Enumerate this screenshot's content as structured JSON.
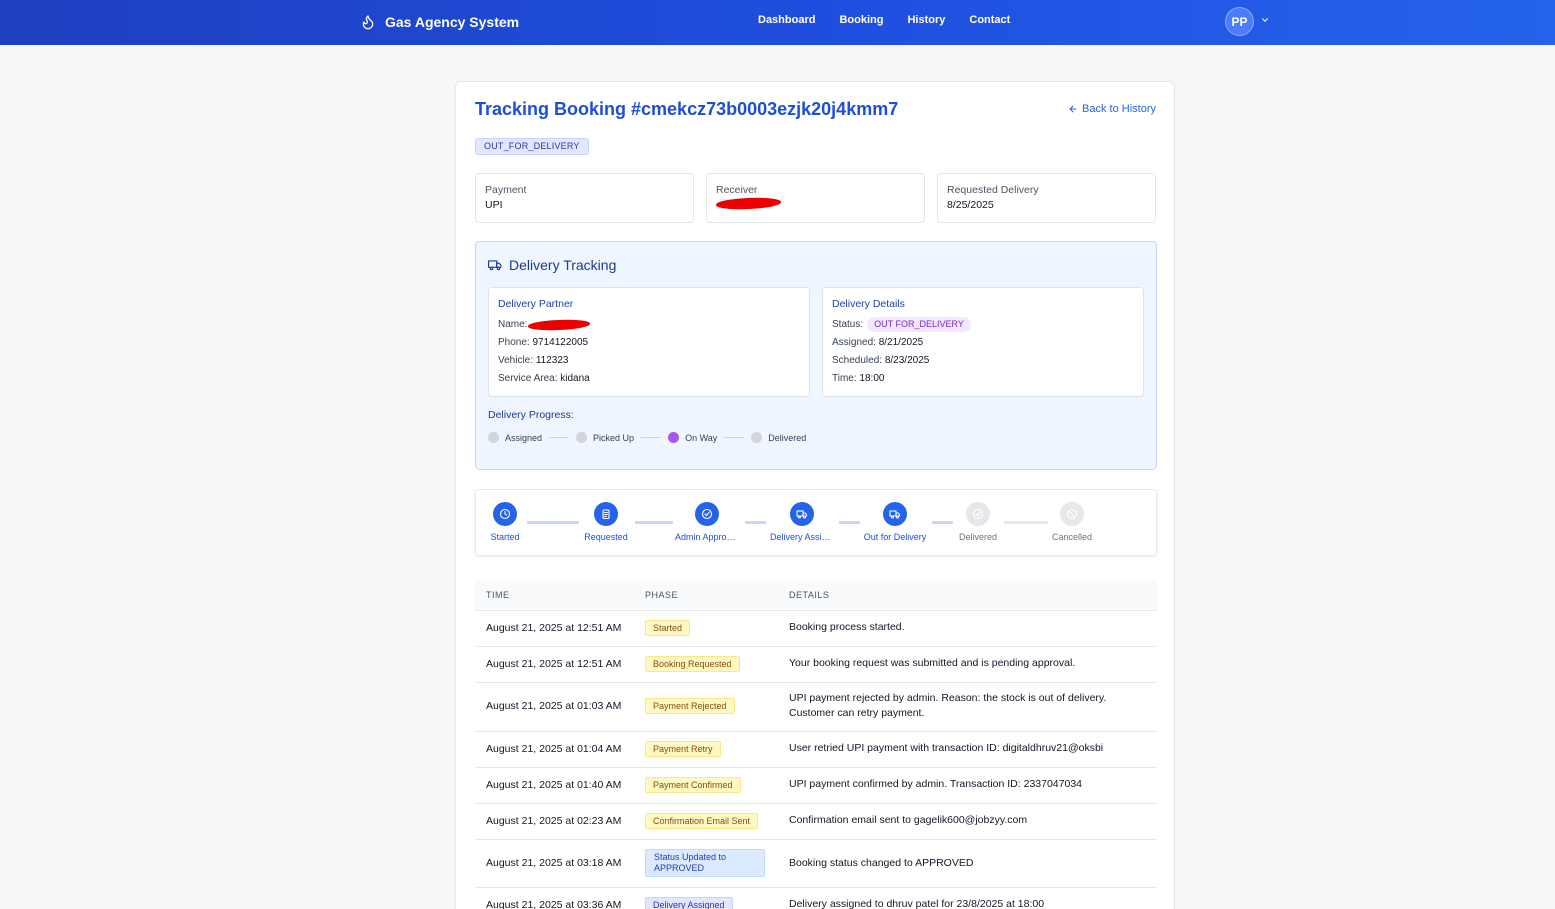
{
  "header": {
    "brand": "Gas Agency System",
    "nav": [
      "Dashboard",
      "Booking",
      "History",
      "Contact"
    ],
    "avatar_initials": "PP"
  },
  "page": {
    "title": "Tracking Booking #cmekcz73b0003ezjk20j4kmm7",
    "back_label": "Back to History",
    "status": "OUT_FOR_DELIVERY"
  },
  "info_cards": {
    "payment_label": "Payment",
    "payment_value": "UPI",
    "receiver_label": "Receiver",
    "requested_label": "Requested Delivery",
    "requested_value": "8/25/2025"
  },
  "delivery_tracking": {
    "title": "Delivery Tracking",
    "partner": {
      "heading": "Delivery Partner",
      "name_label": "Name:",
      "phone_label": "Phone:",
      "phone": "9714122005",
      "vehicle_label": "Vehicle:",
      "vehicle": "112323",
      "area_label": "Service Area:",
      "area": "kidana"
    },
    "details": {
      "heading": "Delivery Details",
      "status_label": "Status:",
      "status": "OUT FOR_DELIVERY",
      "assigned_label": "Assigned:",
      "assigned": "8/21/2025",
      "scheduled_label": "Scheduled:",
      "scheduled": "8/23/2025",
      "time_label": "Time:",
      "time": "18:00"
    },
    "progress_label": "Delivery Progress:",
    "progress_steps": [
      "Assigned",
      "Picked Up",
      "On Way",
      "Delivered"
    ],
    "progress_active": "On Way"
  },
  "stepper": {
    "steps": [
      {
        "label": "Started",
        "icon": "clock-icon",
        "done": true
      },
      {
        "label": "Requested",
        "icon": "clipboard-icon",
        "done": true
      },
      {
        "label": "Admin Approved",
        "icon": "check-circle-icon",
        "done": true
      },
      {
        "label": "Delivery Assigned",
        "icon": "truck-icon",
        "done": true
      },
      {
        "label": "Out for Delivery",
        "icon": "truck-icon",
        "done": true
      },
      {
        "label": "Delivered",
        "icon": "check-circle-icon",
        "done": false
      },
      {
        "label": "Cancelled",
        "icon": "ban-icon",
        "done": false
      }
    ]
  },
  "history_table": {
    "columns": [
      "TIME",
      "PHASE",
      "DETAILS"
    ],
    "rows": [
      {
        "time": "August 21, 2025 at 12:51 AM",
        "phase": "Started",
        "details": "Booking process started."
      },
      {
        "time": "August 21, 2025 at 12:51 AM",
        "phase": "Booking Requested",
        "details": "Your booking request was submitted and is pending approval."
      },
      {
        "time": "August 21, 2025 at 01:03 AM",
        "phase": "Payment Rejected",
        "details": "UPI payment rejected by admin. Reason: the stock is out of delivery.",
        "details2": "Customer can retry payment."
      },
      {
        "time": "August 21, 2025 at 01:04 AM",
        "phase": "Payment Retry",
        "details": "User retried UPI payment with transaction ID: digitaldhruv21@oksbi"
      },
      {
        "time": "August 21, 2025 at 01:40 AM",
        "phase": "Payment Confirmed",
        "details": "UPI payment confirmed by admin. Transaction ID: 2337047034"
      },
      {
        "time": "August 21, 2025 at 02:23 AM",
        "phase": "Confirmation Email Sent",
        "details": "Confirmation email sent to gagelik600@jobzyy.com"
      },
      {
        "time": "August 21, 2025 at 03:18 AM",
        "phase": "Status Updated to APPROVED",
        "details": "Booking status changed to APPROVED"
      },
      {
        "time": "August 21, 2025 at 03:36 AM",
        "phase": "Delivery Assigned",
        "details": "Delivery assigned to dhruv patel for 23/8/2025 at 18:00"
      }
    ]
  },
  "colors": {
    "primary": "#2563eb",
    "header_bg": "#1f4fe0",
    "active_progress": "#a855f7"
  }
}
